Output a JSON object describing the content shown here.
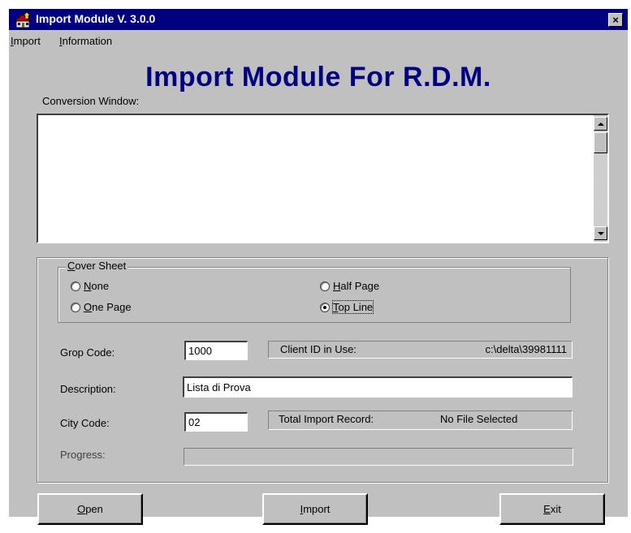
{
  "window": {
    "title": "Import Module V. 3.0.0",
    "close_label": "×",
    "app_icon": "house-arrow-icon"
  },
  "menu": {
    "items": [
      {
        "first": "I",
        "rest": "mport"
      },
      {
        "first": "I",
        "rest": "nformation"
      }
    ]
  },
  "header": {
    "title": "Import Module For R.D.M."
  },
  "conversion": {
    "label": "Conversion Window:",
    "content": ""
  },
  "cover_sheet": {
    "legend_first": "C",
    "legend_rest": "over Sheet",
    "options": [
      {
        "first": "N",
        "rest": "one",
        "checked": false
      },
      {
        "first": "O",
        "rest": "ne Page",
        "checked": false
      },
      {
        "first": "H",
        "rest": "alf Page",
        "checked": false
      },
      {
        "first": "T",
        "rest": "op Line",
        "checked": true
      }
    ]
  },
  "form": {
    "group_code_label": "Grop Code:",
    "group_code_value": "1000",
    "client_id_label": "Client ID in Use:",
    "client_id_value": "c:\\delta\\39981111",
    "description_label": "Description:",
    "description_value": "Lista di Prova",
    "city_code_label": "City Code:",
    "city_code_value": "02",
    "total_label": "Total Import Record:",
    "total_value": "No File Selected",
    "progress_label": "Progress:",
    "progress_value": 0
  },
  "buttons": {
    "open": {
      "first": "O",
      "rest": "pen"
    },
    "import": {
      "first": "I",
      "rest": "mport"
    },
    "exit": {
      "first": "E",
      "rest": "xit"
    }
  },
  "colors": {
    "titlebar": "#000080",
    "face": "#c0c0c0",
    "header_text": "#000080"
  }
}
